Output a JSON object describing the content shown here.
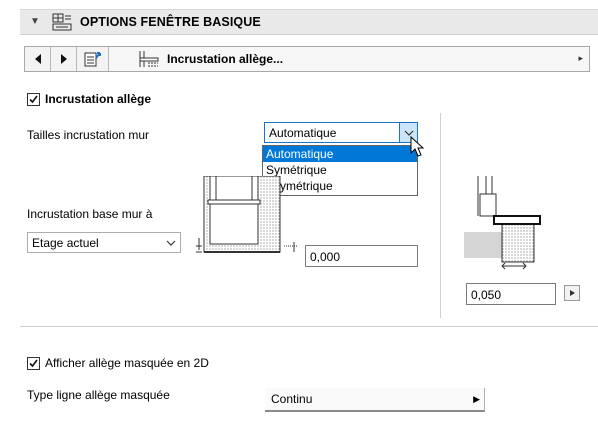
{
  "header": {
    "title": "OPTIONS FENÊTRE BASIQUE",
    "collapse_icon": "triangle-down-icon"
  },
  "navigator": {
    "prev_icon": "triangle-left-icon",
    "next_icon": "triangle-right-icon",
    "selected_label": "Incrustation allège...",
    "arrow": "▸"
  },
  "options": {
    "sill_checkbox": {
      "label": "Incrustation allège",
      "checked": true
    },
    "wall_sizes": {
      "label": "Tailles incrustation mur",
      "value": "Automatique",
      "options": [
        "Automatique",
        "Symétrique",
        "Asymétrique"
      ]
    },
    "base_wall": {
      "label": "Incrustation base mur à",
      "value": "Etage actuel"
    },
    "offset_value": "0,000",
    "depth_value": "0,050"
  },
  "display": {
    "hidden_sill_checkbox": {
      "label": "Afficher allège masquée en 2D",
      "checked": true
    },
    "line_type": {
      "label": "Type ligne allège masquée",
      "value": "Continu"
    }
  },
  "colors": {
    "selection": "#0078d7",
    "header_bg": "#e9e9e9"
  }
}
